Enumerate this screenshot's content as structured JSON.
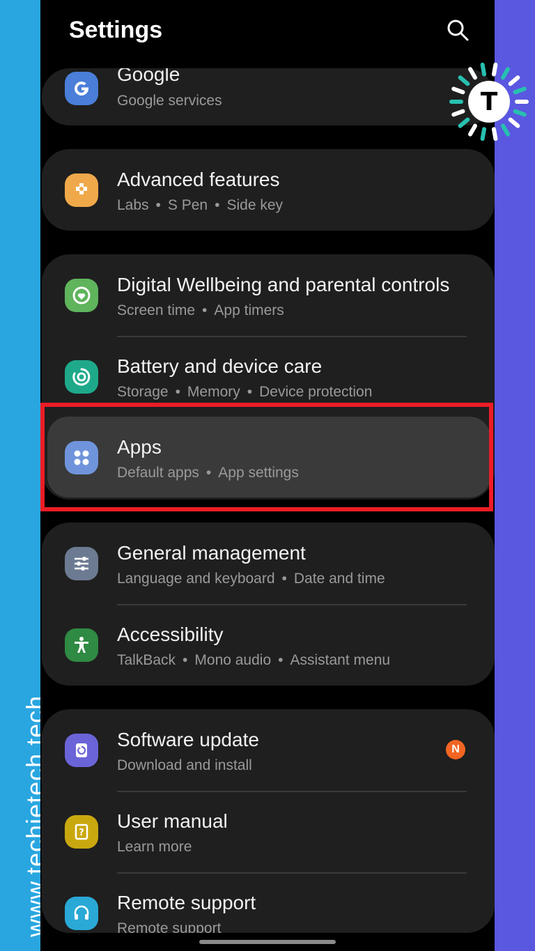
{
  "header": {
    "title": "Settings"
  },
  "watermark": "www.techietech.tech",
  "logo_letter": "T",
  "items": {
    "google": {
      "title": "Google",
      "subtitle": "Google services",
      "icon": "google-icon",
      "color": "#4a7ed8"
    },
    "advanced": {
      "title": "Advanced features",
      "subtitle": [
        "Labs",
        "S Pen",
        "Side key"
      ],
      "icon": "advanced-features-icon",
      "color": "#f0a94a"
    },
    "wellbeing": {
      "title": "Digital Wellbeing and parental controls",
      "subtitle": [
        "Screen time",
        "App timers"
      ],
      "icon": "digital-wellbeing-icon",
      "color": "#5fb45c"
    },
    "battery": {
      "title": "Battery and device care",
      "subtitle": [
        "Storage",
        "Memory",
        "Device protection"
      ],
      "icon": "device-care-icon",
      "color": "#1ea98a"
    },
    "apps": {
      "title": "Apps",
      "subtitle": [
        "Default apps",
        "App settings"
      ],
      "icon": "apps-icon",
      "color": "#6f94dc"
    },
    "general": {
      "title": "General management",
      "subtitle": [
        "Language and keyboard",
        "Date and time"
      ],
      "icon": "general-management-icon",
      "color": "#6d7b92"
    },
    "accessibility": {
      "title": "Accessibility",
      "subtitle": [
        "TalkBack",
        "Mono audio",
        "Assistant menu"
      ],
      "icon": "accessibility-icon",
      "color": "#2f8a43"
    },
    "software": {
      "title": "Software update",
      "subtitle": "Download and install",
      "icon": "software-update-icon",
      "color": "#6b64d8",
      "badge": "N"
    },
    "manual": {
      "title": "User manual",
      "subtitle": "Learn more",
      "icon": "user-manual-icon",
      "color": "#c9a80f"
    },
    "remote": {
      "title": "Remote support",
      "subtitle": "Remote support",
      "icon": "remote-support-icon",
      "color": "#2aa9d6"
    }
  },
  "colors": {
    "highlight": "#ee1c25",
    "badge": "#f26522",
    "left_band": "#29a6e0",
    "right_band": "#5a57e0"
  }
}
